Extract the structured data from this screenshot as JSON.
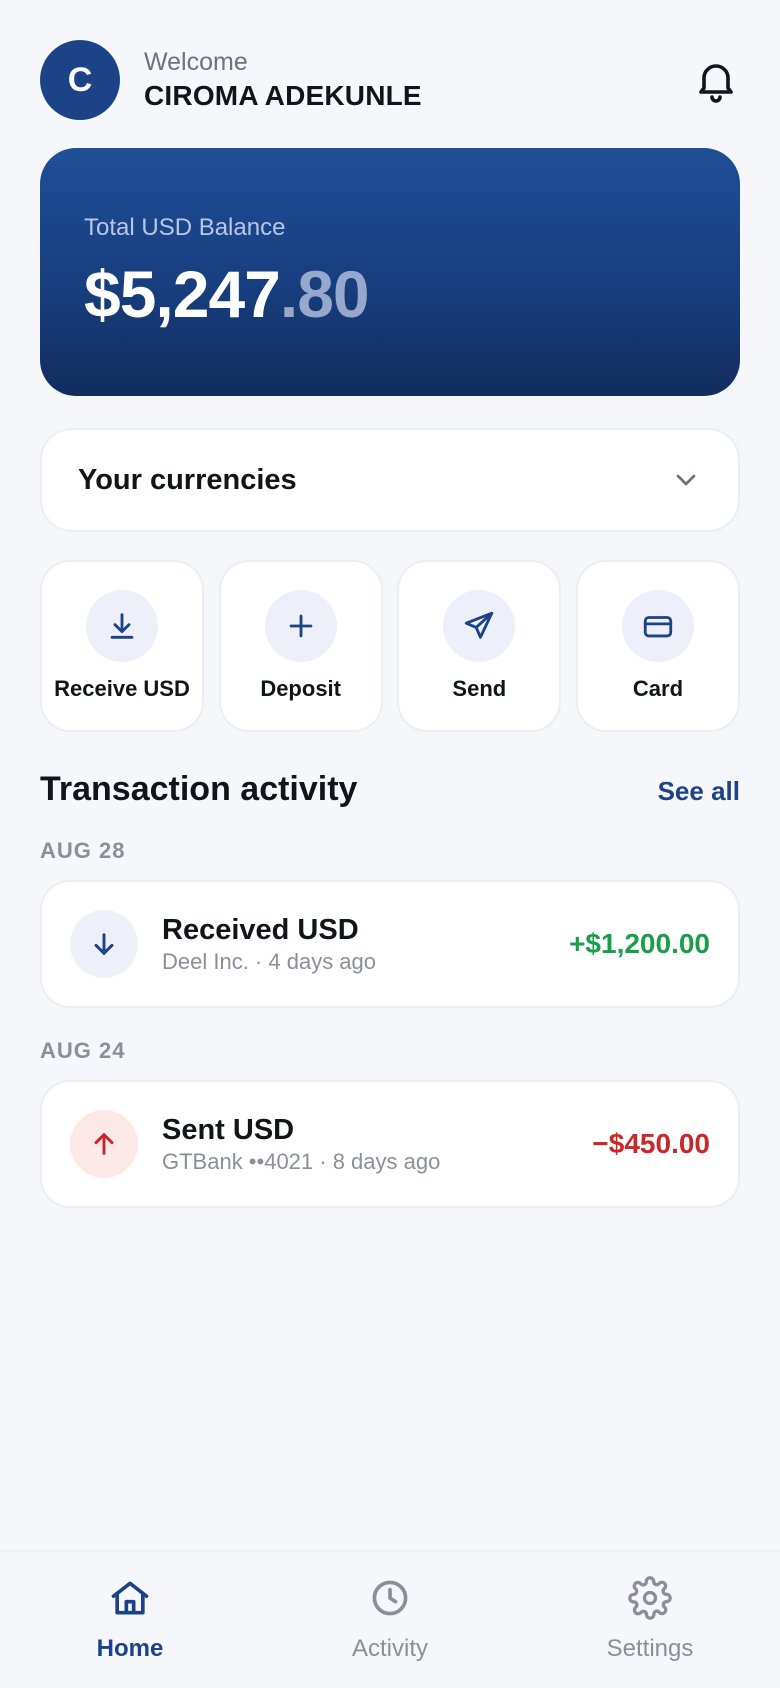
{
  "header": {
    "avatar_initial": "C",
    "welcome": "Welcome",
    "user_name": "CIROMA ADEKUNLE",
    "notification_icon": "bell-icon"
  },
  "balance": {
    "label": "Total USD Balance",
    "whole": "$5,247",
    "cents": ".80"
  },
  "currencies": {
    "label": "Your currencies",
    "icon": "chevron-down-icon"
  },
  "actions": [
    {
      "label": "Receive USD",
      "icon": "download-icon"
    },
    {
      "label": "Deposit",
      "icon": "plus-icon"
    },
    {
      "label": "Send",
      "icon": "send-icon"
    },
    {
      "label": "Card",
      "icon": "card-icon"
    }
  ],
  "activity": {
    "title": "Transaction activity",
    "see_all": "See all",
    "groups": [
      {
        "date": "AUG 28",
        "transactions": [
          {
            "title": "Received USD",
            "subtitle": "Deel Inc. · 4 days ago",
            "amount": "+$1,200.00",
            "direction": "in"
          }
        ]
      },
      {
        "date": "AUG 24",
        "transactions": [
          {
            "title": "Sent USD",
            "subtitle": "GTBank ••4021 · 8 days ago",
            "amount": "−$450.00",
            "direction": "out"
          }
        ]
      }
    ]
  },
  "nav": [
    {
      "label": "Home",
      "icon": "home-icon",
      "active": true
    },
    {
      "label": "Activity",
      "icon": "clock-icon",
      "active": false
    },
    {
      "label": "Settings",
      "icon": "gear-icon",
      "active": false
    }
  ],
  "colors": {
    "brand": "#1c4388",
    "positive": "#1a9e4b",
    "negative": "#c8282b",
    "background": "#f6f7fb"
  }
}
